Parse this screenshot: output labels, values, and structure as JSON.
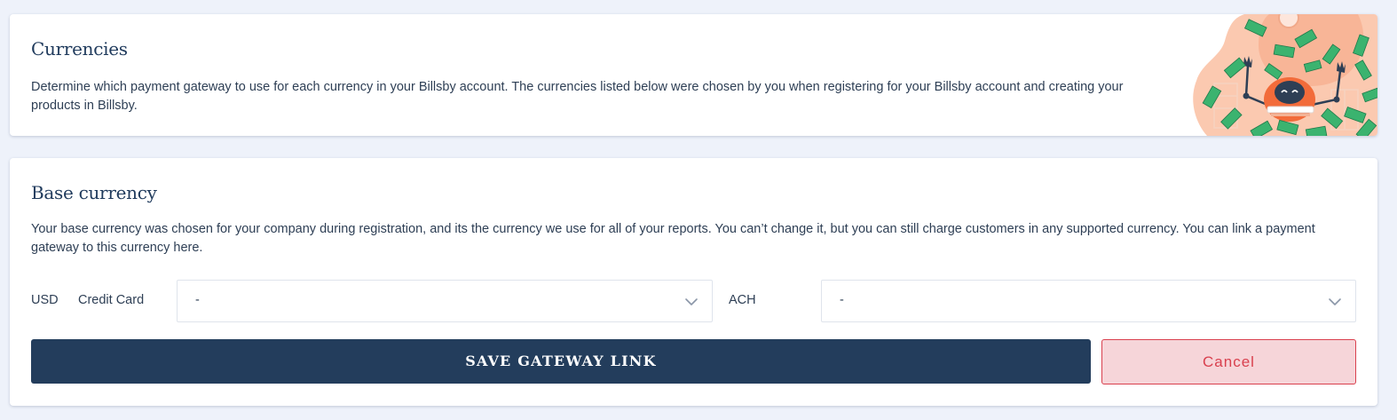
{
  "currencies_card": {
    "title": "Currencies",
    "description": "Determine which payment gateway to use for each currency in your Billsby account. The currencies listed below were chosen by you when registering for your Billsby account and creating your products in Billsby."
  },
  "base_currency_card": {
    "title": "Base currency",
    "description": "Your base currency was chosen for your company during registration, and its the currency we use for all of your reports. You can’t change it, but you can still charge customers in any supported currency. You can link a payment gateway to this currency here.",
    "currency_code": "USD",
    "credit_card_label": "Credit Card",
    "credit_card_value": "-",
    "ach_label": "ACH",
    "ach_value": "-",
    "save_label": "SAVE GATEWAY LINK",
    "cancel_label": "Cancel"
  },
  "colors": {
    "page_bg": "#eef2fa",
    "primary": "#233d5c",
    "cancel_text": "#d9404e",
    "cancel_bg": "#f6d5d9"
  },
  "icons": [
    "chevron-down-icon",
    "money-robot-illustration"
  ]
}
